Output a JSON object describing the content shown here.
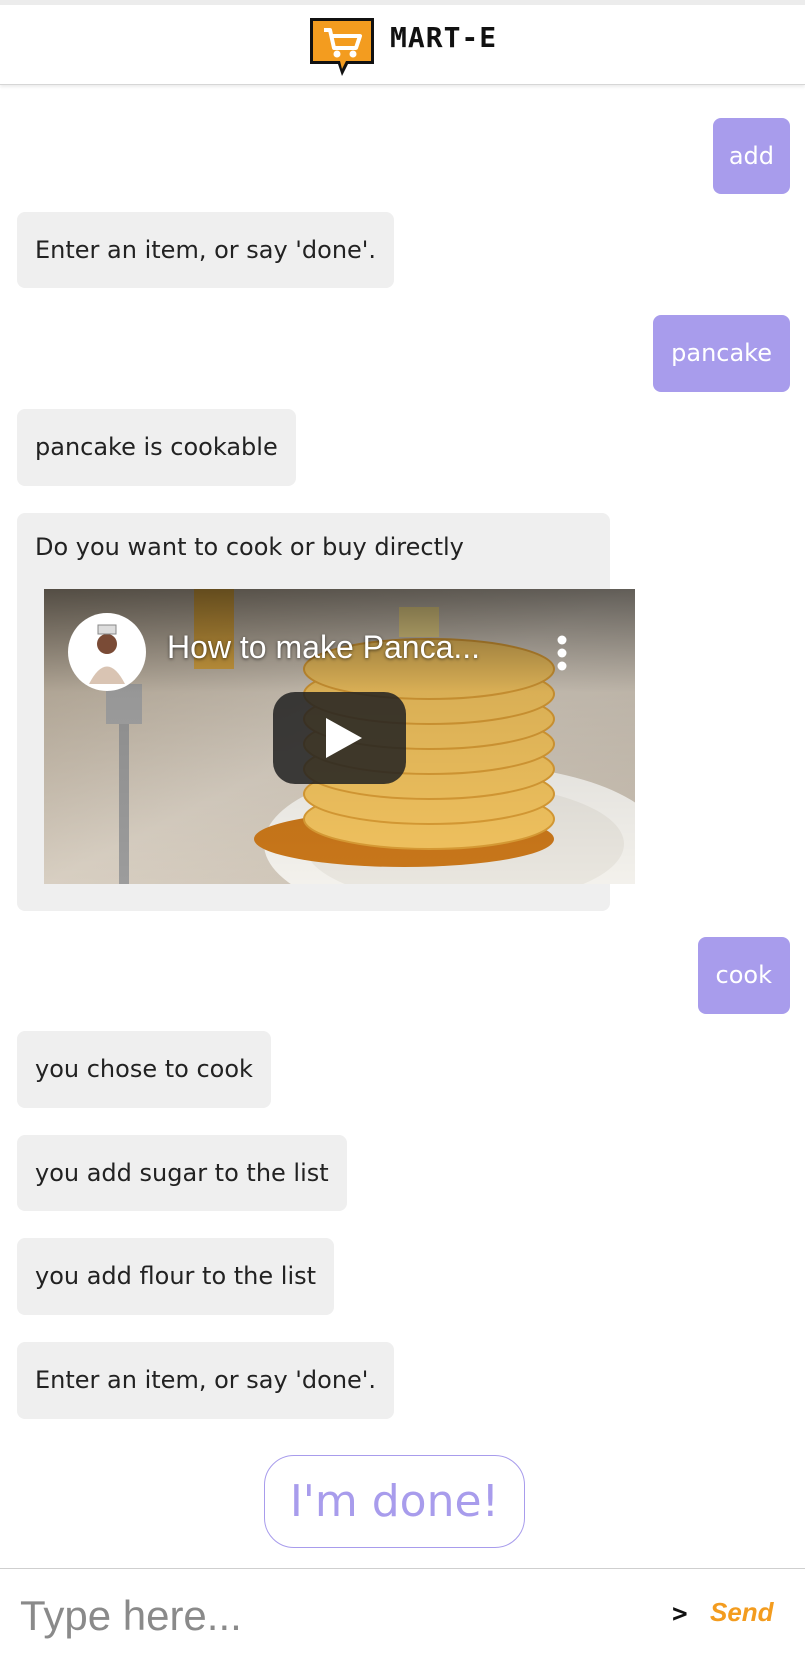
{
  "header": {
    "app_title": "MART-E",
    "logo_icon": "shopping-cart-icon",
    "logo_color": "#f39c1f"
  },
  "messages": [
    {
      "role": "user",
      "text": "add"
    },
    {
      "role": "bot",
      "text": "Enter an item, or say 'done'."
    },
    {
      "role": "user",
      "text": "pancake"
    },
    {
      "role": "bot",
      "text": "pancake is cookable"
    },
    {
      "role": "bot",
      "text": "Do you want to cook or buy directly"
    },
    {
      "role": "user",
      "text": "cook"
    },
    {
      "role": "bot",
      "text": "you chose to cook"
    },
    {
      "role": "bot",
      "text": "you add sugar to the list"
    },
    {
      "role": "bot",
      "text": "you add flour to the list"
    },
    {
      "role": "bot",
      "text": "Enter an item, or say 'done'."
    }
  ],
  "video": {
    "title": "How to make Panca...",
    "channel_avatar_icon": "chef-avatar-icon",
    "play_icon": "play-icon",
    "menu_icon": "more-vertical-icon"
  },
  "done_button": {
    "label": "I'm done!"
  },
  "composer": {
    "placeholder": "Type here...",
    "prompt_icon": "chevron-right-icon",
    "send_label": "Send"
  },
  "colors": {
    "user_bubble": "#a89cec",
    "bot_bubble": "#efefef",
    "accent": "#f39c1f"
  }
}
